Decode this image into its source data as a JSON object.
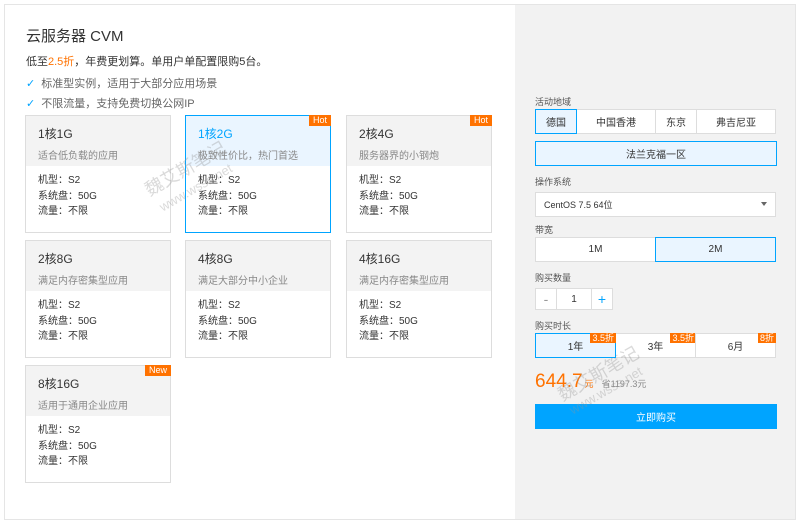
{
  "product": {
    "title": "云服务器 CVM",
    "subtitle_pre": "低至",
    "subtitle_discount": "2.5折",
    "subtitle_post": "，年费更划算。单用户单配置限购5台。",
    "features": [
      "标准型实例，适用于大部分应用场景",
      "不限流量，支持免费切换公网IP"
    ]
  },
  "cards": [
    {
      "name": "1核1G",
      "desc": "适合低负载的应用",
      "model": "机型：S2",
      "disk": "系统盘：50G",
      "traffic": "流量：不限",
      "badge": "",
      "selected": false
    },
    {
      "name": "1核2G",
      "desc": "极致性价比，热门首选",
      "model": "机型：S2",
      "disk": "系统盘：50G",
      "traffic": "流量：不限",
      "badge": "Hot",
      "selected": true
    },
    {
      "name": "2核4G",
      "desc": "服务器界的小钢炮",
      "model": "机型：S2",
      "disk": "系统盘：50G",
      "traffic": "流量：不限",
      "badge": "Hot",
      "selected": false
    },
    {
      "name": "2核8G",
      "desc": "满足内存密集型应用",
      "model": "机型：S2",
      "disk": "系统盘：50G",
      "traffic": "流量：不限",
      "badge": "",
      "selected": false
    },
    {
      "name": "4核8G",
      "desc": "满足大部分中小企业",
      "model": "机型：S2",
      "disk": "系统盘：50G",
      "traffic": "流量：不限",
      "badge": "",
      "selected": false
    },
    {
      "name": "4核16G",
      "desc": "满足内存密集型应用",
      "model": "机型：S2",
      "disk": "系统盘：50G",
      "traffic": "流量：不限",
      "badge": "",
      "selected": false
    },
    {
      "name": "8核16G",
      "desc": "适用于通用企业应用",
      "model": "机型：S2",
      "disk": "系统盘：50G",
      "traffic": "流量：不限",
      "badge": "New",
      "selected": false
    }
  ],
  "region": {
    "label": "活动地域",
    "options": [
      "德国",
      "中国香港",
      "东京",
      "弗吉尼亚"
    ],
    "selected": "德国",
    "zone": "法兰克福一区"
  },
  "os": {
    "label": "操作系统",
    "value": "CentOS 7.5 64位"
  },
  "bandwidth": {
    "label": "带宽",
    "options": [
      "1M",
      "2M"
    ],
    "selected": "2M"
  },
  "quantity": {
    "label": "购买数量",
    "minus": "-",
    "value": "1",
    "plus": "+"
  },
  "duration": {
    "label": "购买时长",
    "options": [
      {
        "label": "1年",
        "tag": "3.5折"
      },
      {
        "label": "3年",
        "tag": "3.5折"
      },
      {
        "label": "6月",
        "tag": "8折"
      }
    ],
    "selected": "1年"
  },
  "price": {
    "amount": "644.7",
    "unit": "元",
    "saving": "省1197.3元"
  },
  "buy_label": "立即购买",
  "watermark": {
    "text1": "魏艾斯笔记",
    "text2": "www.wsss.net",
    "text3": "魏艾斯笔记",
    "text4": "www.wsss.net"
  },
  "colors": {
    "accent": "#00a4ff",
    "badge": "#ff7200"
  }
}
